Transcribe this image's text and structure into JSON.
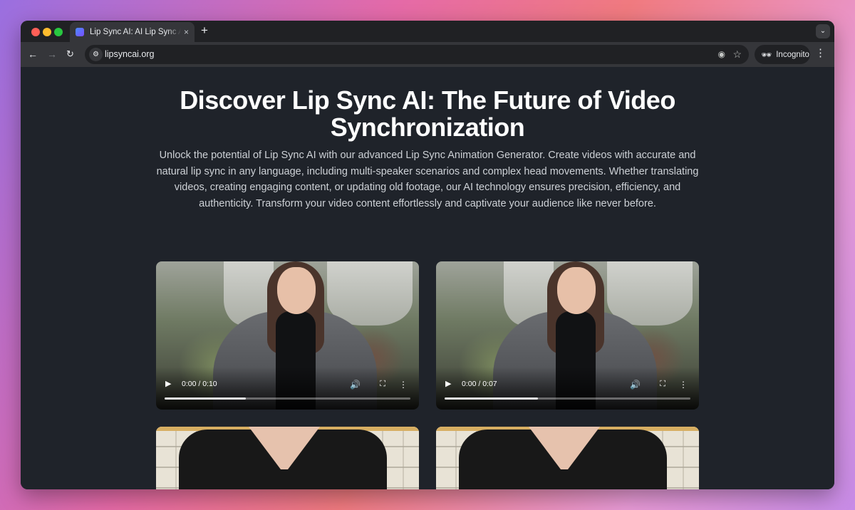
{
  "browser": {
    "tab": {
      "title": "Lip Sync AI: AI Lip Sync Animation Generator",
      "close": "×"
    },
    "new_tab": "+",
    "url": "lipsyncai.org",
    "incognito_label": "Incognito"
  },
  "page": {
    "headline": "Discover Lip Sync AI: The Future of Video Synchronization",
    "description": "Unlock the potential of Lip Sync AI with our advanced Lip Sync Animation Generator. Create videos with accurate and natural lip sync in any language, including multi-speaker scenarios and complex head movements. Whether translating videos, creating engaging content, or updating old footage, our AI technology ensures precision, efficiency, and authenticity. Transform your video content effortlessly and captivate your audience like never before."
  },
  "videos": [
    {
      "time": "0:00 / 0:10",
      "progress": 0.33
    },
    {
      "time": "0:00 / 0:07",
      "progress": 0.38
    }
  ],
  "icons": {
    "back": "arrow-left-icon",
    "forward": "arrow-right-icon",
    "reload": "reload-icon",
    "site_info": "tune-icon",
    "eye_off": "eye-off-icon",
    "bookmark": "star-icon",
    "incognito": "incognito-icon",
    "menu": "more-vert-icon",
    "play": "play-icon",
    "volume": "volume-icon",
    "fullscreen": "fullscreen-icon",
    "video_menu": "more-vert-icon"
  }
}
